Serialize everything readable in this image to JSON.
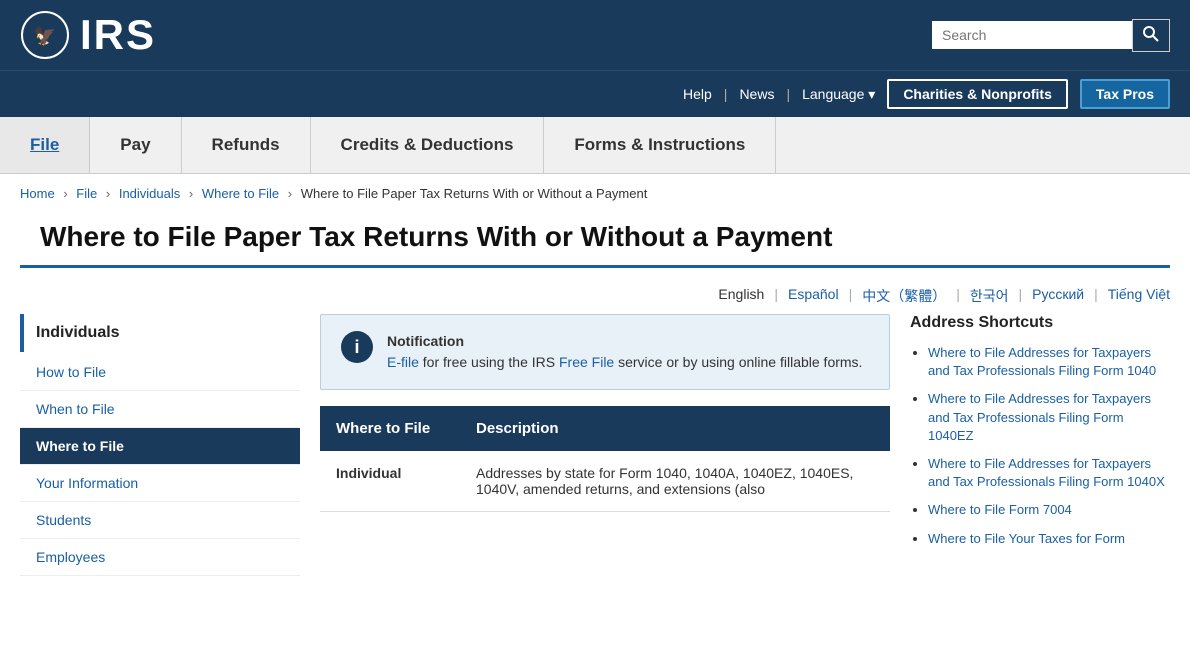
{
  "header": {
    "logo_text": "IRS",
    "search_placeholder": "Search",
    "search_button_label": "Search",
    "nav_links": [
      {
        "label": "Help",
        "url": "#"
      },
      {
        "label": "News",
        "url": "#"
      },
      {
        "label": "Language",
        "url": "#",
        "has_dropdown": true
      }
    ],
    "buttons": [
      {
        "label": "Charities & Nonprofits",
        "style": "outline"
      },
      {
        "label": "Tax Pros",
        "style": "solid"
      }
    ]
  },
  "main_nav": {
    "items": [
      {
        "label": "File",
        "active": true
      },
      {
        "label": "Pay",
        "active": false
      },
      {
        "label": "Refunds",
        "active": false
      },
      {
        "label": "Credits & Deductions",
        "active": false
      },
      {
        "label": "Forms & Instructions",
        "active": false
      }
    ]
  },
  "breadcrumb": {
    "items": [
      {
        "label": "Home",
        "url": "#"
      },
      {
        "label": "File",
        "url": "#"
      },
      {
        "label": "Individuals",
        "url": "#"
      },
      {
        "label": "Where to File",
        "url": "#"
      },
      {
        "label": "Where to File Paper Tax Returns With or Without a Payment",
        "url": null
      }
    ]
  },
  "page_title": "Where to File Paper Tax Returns With or Without a Payment",
  "languages": [
    {
      "label": "English",
      "url": null
    },
    {
      "label": "Español",
      "url": "#"
    },
    {
      "label": "中文（繁體）",
      "url": "#"
    },
    {
      "label": "한국어",
      "url": "#"
    },
    {
      "label": "Русский",
      "url": "#"
    },
    {
      "label": "Tiếng Việt",
      "url": "#"
    }
  ],
  "sidebar": {
    "title": "Individuals",
    "items": [
      {
        "label": "How to File",
        "active": false
      },
      {
        "label": "When to File",
        "active": false
      },
      {
        "label": "Where to File",
        "active": true
      },
      {
        "label": "Your Information",
        "active": false
      },
      {
        "label": "Students",
        "active": false
      },
      {
        "label": "Employees",
        "active": false
      }
    ]
  },
  "notification": {
    "icon": "i",
    "title": "Notification",
    "text_before_link1": "",
    "link1_text": "E-file",
    "text_middle": " for free using the IRS ",
    "link2_text": "Free File",
    "text_after": " service or by using online fillable forms."
  },
  "table": {
    "headers": [
      "Where to File",
      "Description"
    ],
    "rows": [
      {
        "col1": "Individual",
        "col2": "Addresses by state for Form 1040, 1040A, 1040EZ, 1040ES, 1040V, amended returns, and extensions (also"
      }
    ]
  },
  "right_sidebar": {
    "title": "Address Shortcuts",
    "links": [
      {
        "label": "Where to File Addresses for Taxpayers and Tax Professionals Filing Form 1040",
        "url": "#"
      },
      {
        "label": "Where to File Addresses for Taxpayers and Tax Professionals Filing Form 1040EZ",
        "url": "#"
      },
      {
        "label": "Where to File Addresses for Taxpayers and Tax Professionals Filing Form 1040X",
        "url": "#"
      },
      {
        "label": "Where to File Form 7004",
        "url": "#"
      },
      {
        "label": "Where to File Your Taxes for Form",
        "url": "#"
      }
    ]
  }
}
